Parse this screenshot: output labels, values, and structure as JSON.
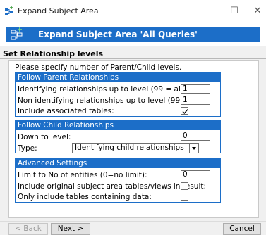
{
  "window": {
    "title": "Expand Subject Area",
    "controls": {
      "minimize": "—",
      "maximize": "☐",
      "close": "✕"
    }
  },
  "header": {
    "title": "Expand Subject Area 'All Queries'"
  },
  "section_title": "Set Relationship levels",
  "hint": "Please specify number of Parent/Child levels.",
  "parent_group": {
    "title": "Follow Parent Relationships",
    "identifying_label": "Identifying relationships up to level (99 = all):",
    "identifying_value": "1",
    "non_identifying_label": "Non identifying relationships up to level (99 = all):",
    "non_identifying_value": "1",
    "associated_label": "Include associated tables:",
    "associated_checked": true
  },
  "child_group": {
    "title": "Follow Child Relationships",
    "down_label": "Down to level:",
    "down_value": "0",
    "type_label": "Type:",
    "type_value": "Identifying child relationships"
  },
  "advanced_group": {
    "title": "Advanced Settings",
    "limit_label": "Limit to No of entities (0=no limit):",
    "limit_value": "0",
    "include_original_label": "Include original subject area tables/views in result:",
    "include_original_checked": false,
    "only_data_label": "Only include tables containing data:",
    "only_data_checked": false
  },
  "buttons": {
    "back": "< Back",
    "next": "Next >",
    "cancel": "Cancel"
  }
}
